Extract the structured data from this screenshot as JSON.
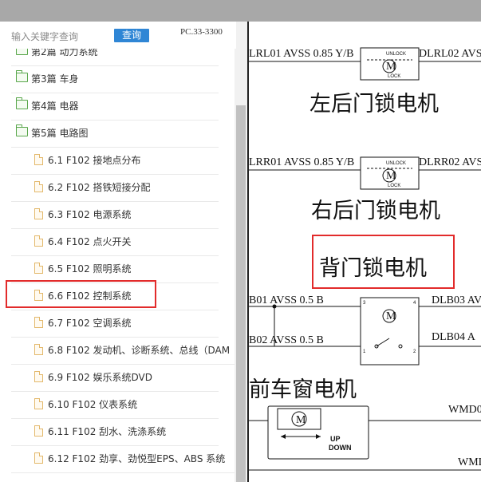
{
  "search": {
    "placeholder": "输入关键字查询",
    "button_label": "查询",
    "pc_code": "PC.33-3300"
  },
  "tree": {
    "chapters": [
      {
        "label": "第2篇 动力系统"
      },
      {
        "label": "第3篇 车身"
      },
      {
        "label": "第4篇 电器"
      },
      {
        "label": "第5篇 电路图"
      }
    ],
    "items": [
      {
        "label": "6.1 F102 接地点分布"
      },
      {
        "label": "6.2 F102 搭铁短接分配"
      },
      {
        "label": "6.3 F102 电源系统"
      },
      {
        "label": "6.4 F102 点火开关"
      },
      {
        "label": "6.5 F102 照明系统"
      },
      {
        "label": "6.6 F102 控制系统"
      },
      {
        "label": "6.7 F102 空调系统"
      },
      {
        "label": "6.8 F102 发动机、诊断系统、总线（DAM"
      },
      {
        "label": "6.9 F102 娱乐系统DVD"
      },
      {
        "label": "6.10 F102 仪表系统"
      },
      {
        "label": "6.11 F102 刮水、洗涤系统"
      },
      {
        "label": "6.12 F102 劲享、劲悦型EPS、ABS 系统"
      }
    ],
    "selected_index": 5
  },
  "diagram": {
    "blocks": [
      {
        "left_wire": "LRL01 AVSS 0.85 Y/B",
        "right_wire": "DLRL02 AVSS",
        "caption": "左后门锁电机"
      },
      {
        "left_wire": "LRR01 AVSS 0.85 Y/B",
        "right_wire": "DLRR02 AVSS",
        "caption": "右后门锁电机"
      },
      {
        "caption": "背门锁电机"
      },
      {
        "left_wire": "B01 AVSS 0.5 B",
        "left_wire_2": "B02 AVSS 0.5 B",
        "right_wire": "DLB03 AV",
        "right_wire_2": "DLB04 A",
        "caption": "前车窗电机"
      },
      {
        "right_wire": "WMD0",
        "right_wire_2": "WML"
      }
    ],
    "symbols": {
      "unlock": "UNLOCK",
      "lock": "LOCK",
      "up": "UP",
      "down": "DOWN",
      "motor": "M",
      "pin_1": "1",
      "pin_2": "2",
      "pin_3": "3",
      "pin_4": "4"
    },
    "highlight_color": "#e22b2b"
  }
}
